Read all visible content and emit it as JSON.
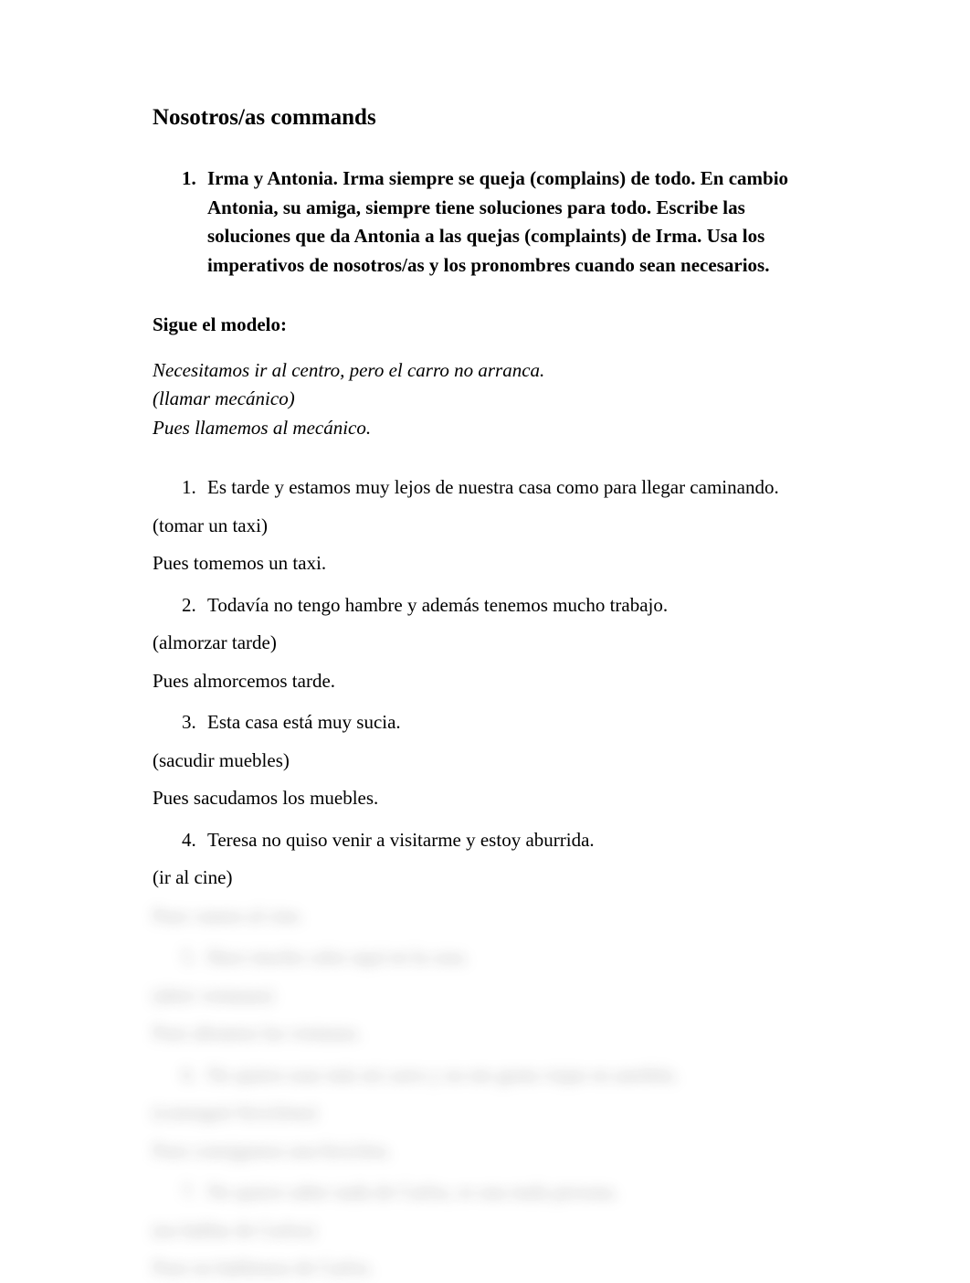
{
  "title": "Nosotros/as commands",
  "instructions": {
    "number": "1.",
    "text": "Irma y Antonia. Irma siempre se queja (complains) de todo. En cambio Antonia, su amiga, siempre tiene soluciones para todo. Escribe las soluciones que da Antonia a las quejas (complaints) de Irma. Usa los imperativos de nosotros/as y los pronombres cuando sean necesarios."
  },
  "follow_model": "Sigue el modelo:",
  "model": {
    "line1": "Necesitamos ir al centro, pero el carro no arranca.",
    "line2": "(llamar mecánico)",
    "line3": "Pues llamemos al mecánico."
  },
  "questions": [
    {
      "num": "1.",
      "prompt": "Es tarde y estamos muy lejos de nuestra casa como para llegar caminando.",
      "hint": "(tomar un taxi)",
      "answer": "Pues  tomemos un taxi."
    },
    {
      "num": "2.",
      "prompt": "Todavía no tengo hambre y además tenemos mucho trabajo.",
      "hint": "(almorzar tarde)",
      "answer": "Pues  almorcemos tarde."
    },
    {
      "num": "3.",
      "prompt": "Esta casa está muy sucia.",
      "hint": "(sacudir muebles)",
      "answer": "Pues   sacudamos los muebles."
    },
    {
      "num": "4.",
      "prompt": "Teresa no quiso venir a visitarme y estoy aburrida.",
      "hint": "(ir al cine)",
      "answer": "Pues   vamos al cine."
    },
    {
      "num": "5.",
      "prompt": "Hace mucho calor aquí en la casa.",
      "hint": "(abrir ventanas)",
      "answer": "Pues   abramos las ventanas."
    },
    {
      "num": "6.",
      "prompt": "No quiero usar más mi carro y no me gusta viajar en autobús.",
      "hint": "(conseguir bicicletas)",
      "answer": "Pues   consigamos una bicicleta."
    },
    {
      "num": "7.",
      "prompt": "No quiero saber nada de Carlos, es una mala persona.",
      "hint": "(no hablar de Carlos)",
      "answer": "Pues   no hablemos de Carlos."
    }
  ]
}
